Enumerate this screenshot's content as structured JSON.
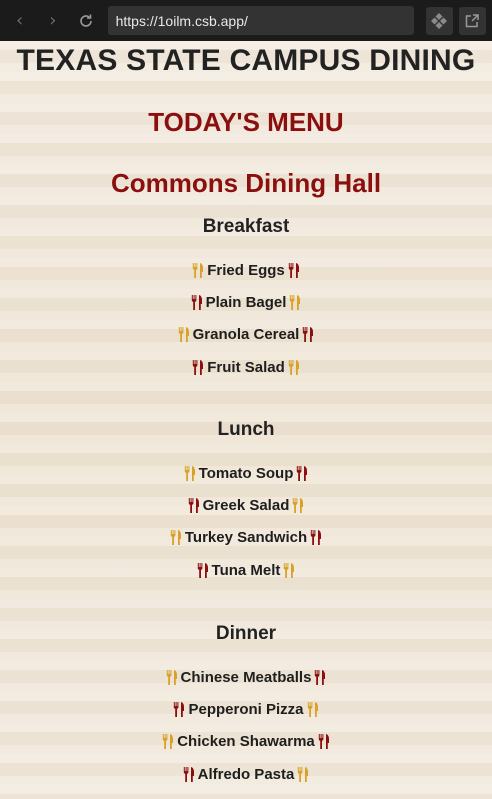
{
  "browser": {
    "url": "https://1oilm.csb.app/",
    "icons": {
      "back": "arrow-left-icon",
      "forward": "arrow-right-icon",
      "reload": "reload-icon",
      "tools": "puzzle-icon",
      "open_external": "open-external-icon"
    }
  },
  "site": {
    "title": "TEXAS STATE CAMPUS DINING",
    "menu_title": "TODAY'S MENU",
    "hall_name": "Commons Dining Hall"
  },
  "colors": {
    "maroon": "#8b0f0f",
    "gold": "#d9a227",
    "text": "#222222",
    "background": "#efe6d8"
  },
  "meals": [
    {
      "name": "Breakfast",
      "items": [
        {
          "label": "Fried Eggs",
          "left_icon": "gold",
          "right_icon": "maroon"
        },
        {
          "label": "Plain Bagel",
          "left_icon": "maroon",
          "right_icon": "gold"
        },
        {
          "label": "Granola Cereal",
          "left_icon": "gold",
          "right_icon": "maroon"
        },
        {
          "label": "Fruit Salad",
          "left_icon": "maroon",
          "right_icon": "gold"
        }
      ]
    },
    {
      "name": "Lunch",
      "items": [
        {
          "label": "Tomato Soup",
          "left_icon": "gold",
          "right_icon": "maroon"
        },
        {
          "label": "Greek Salad",
          "left_icon": "maroon",
          "right_icon": "gold"
        },
        {
          "label": "Turkey Sandwich",
          "left_icon": "gold",
          "right_icon": "maroon"
        },
        {
          "label": "Tuna Melt",
          "left_icon": "maroon",
          "right_icon": "gold"
        }
      ]
    },
    {
      "name": "Dinner",
      "items": [
        {
          "label": "Chinese Meatballs",
          "left_icon": "gold",
          "right_icon": "maroon"
        },
        {
          "label": "Pepperoni Pizza",
          "left_icon": "maroon",
          "right_icon": "gold"
        },
        {
          "label": "Chicken Shawarma",
          "left_icon": "gold",
          "right_icon": "maroon"
        },
        {
          "label": "Alfredo Pasta",
          "left_icon": "maroon",
          "right_icon": "gold"
        }
      ]
    }
  ]
}
